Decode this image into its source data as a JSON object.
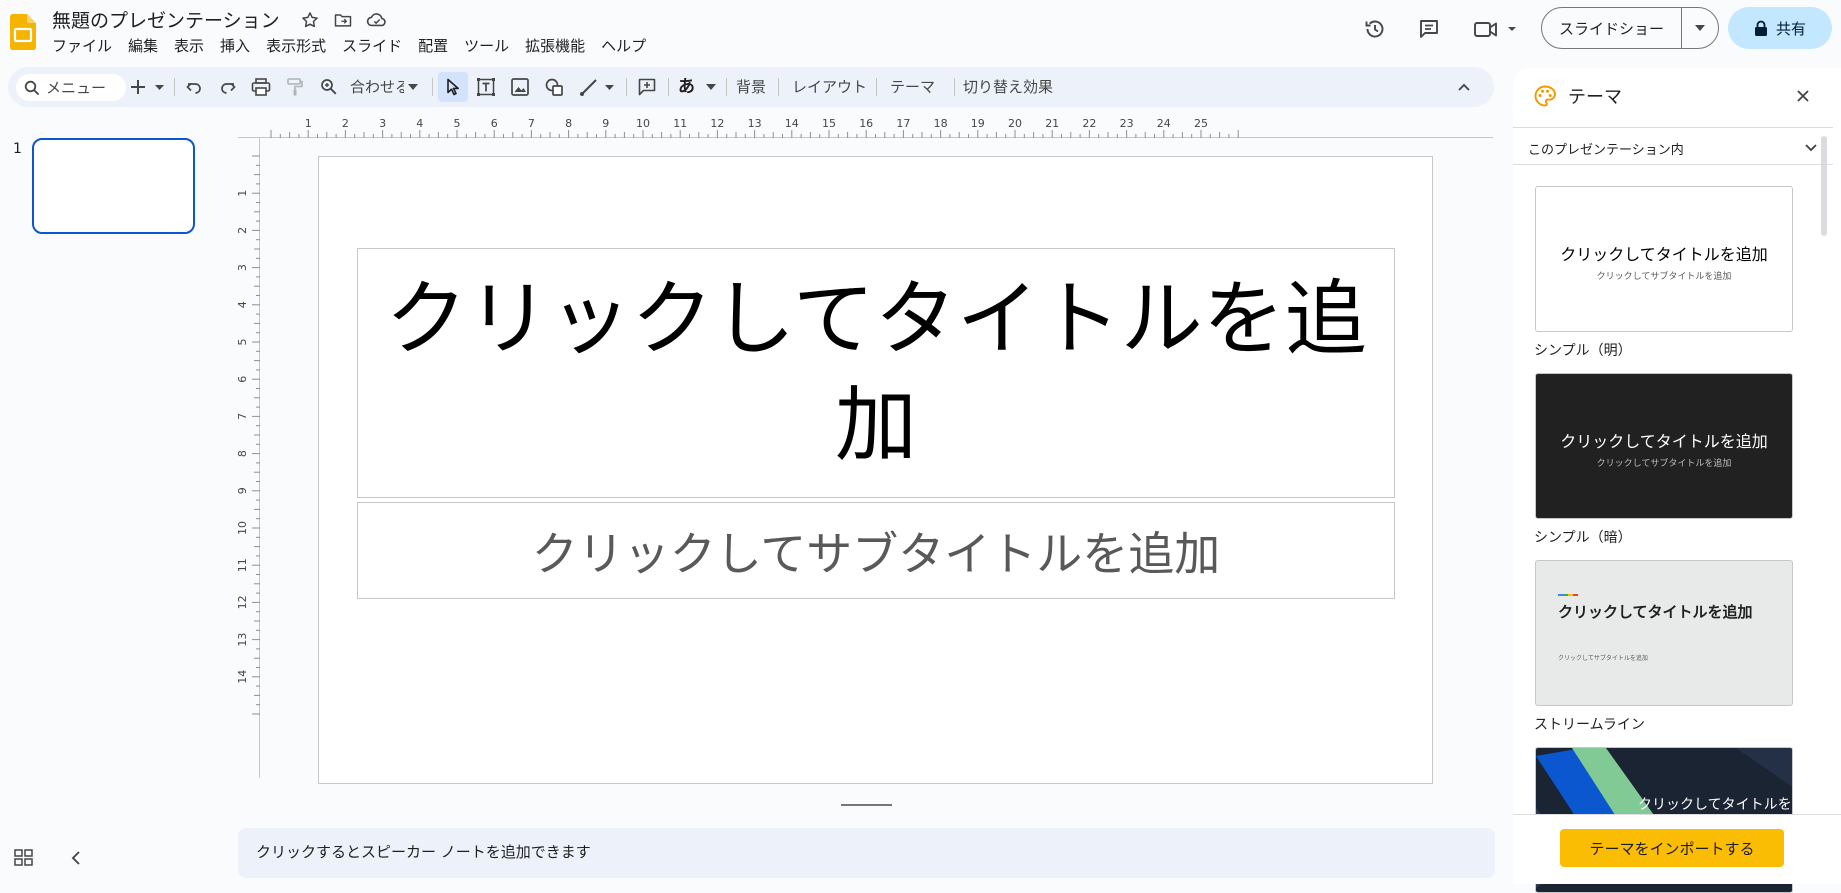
{
  "header": {
    "doc_title": "無題のプレゼンテーション",
    "menu": [
      "ファイル",
      "編集",
      "表示",
      "挿入",
      "表示形式",
      "スライド",
      "配置",
      "ツール",
      "拡張機能",
      "ヘルプ"
    ],
    "slideshow_label": "スライドショー",
    "share_label": "共有",
    "icons": [
      "slides-logo",
      "star-icon",
      "move-folder-icon",
      "cloud-saved-icon",
      "history-icon",
      "comment-icon",
      "video-call-icon",
      "lock-icon"
    ]
  },
  "toolbar": {
    "menu_search": "メニュー",
    "zoom_label": "合わせる",
    "input_tool_label": "あ",
    "background_label": "背景",
    "layout_label": "レイアウト",
    "theme_label": "テーマ",
    "transition_label": "切り替え効果"
  },
  "filmstrip": {
    "slide_number": "1"
  },
  "rulers": {
    "horizontal": [
      "1",
      "2",
      "3",
      "4",
      "5",
      "6",
      "7",
      "8",
      "9",
      "10",
      "11",
      "12",
      "13",
      "14",
      "15",
      "16",
      "17",
      "18",
      "19",
      "20",
      "21",
      "22",
      "23",
      "24",
      "25"
    ],
    "vertical": [
      "1",
      "2",
      "3",
      "4",
      "5",
      "6",
      "7",
      "8",
      "9",
      "10",
      "11",
      "12",
      "13",
      "14"
    ]
  },
  "slide": {
    "title_placeholder": "クリックしてタイトルを追加",
    "subtitle_placeholder": "クリックしてサブタイトルを追加"
  },
  "notes": {
    "placeholder": "クリックするとスピーカー ノートを追加できます"
  },
  "theme_panel": {
    "title": "テーマ",
    "source": "このプレゼンテーション内",
    "import_label": "テーマをインポートする",
    "themes": [
      {
        "name": "シンプル（明）",
        "preview_title": "クリックしてタイトルを追加",
        "preview_subtitle": "クリックしてサブタイトルを追加",
        "bg": "#ffffff",
        "fg": "#000000",
        "sub_fg": "#595959"
      },
      {
        "name": "シンプル（暗）",
        "preview_title": "クリックしてタイトルを追加",
        "preview_subtitle": "クリックしてサブタイトルを追加",
        "bg": "#212121",
        "fg": "#ffffff",
        "sub_fg": "#bdbdbd"
      },
      {
        "name": "ストリームライン",
        "preview_title": "クリックしてタイトルを追加",
        "preview_subtitle": "クリックしてサブタイトルを追加",
        "bg": "#e8eaea",
        "fg": "#1f1f1f",
        "sub_fg": "#595959"
      },
      {
        "name": "",
        "preview_title": "クリックしてタイトルを",
        "bg": "#1b2433",
        "fg": "#ffffff"
      }
    ]
  },
  "colors": {
    "accent": "#0b57d0",
    "share_bg": "#c2e7ff",
    "import_bg": "#fbbc04",
    "logo": "#f4b400"
  }
}
